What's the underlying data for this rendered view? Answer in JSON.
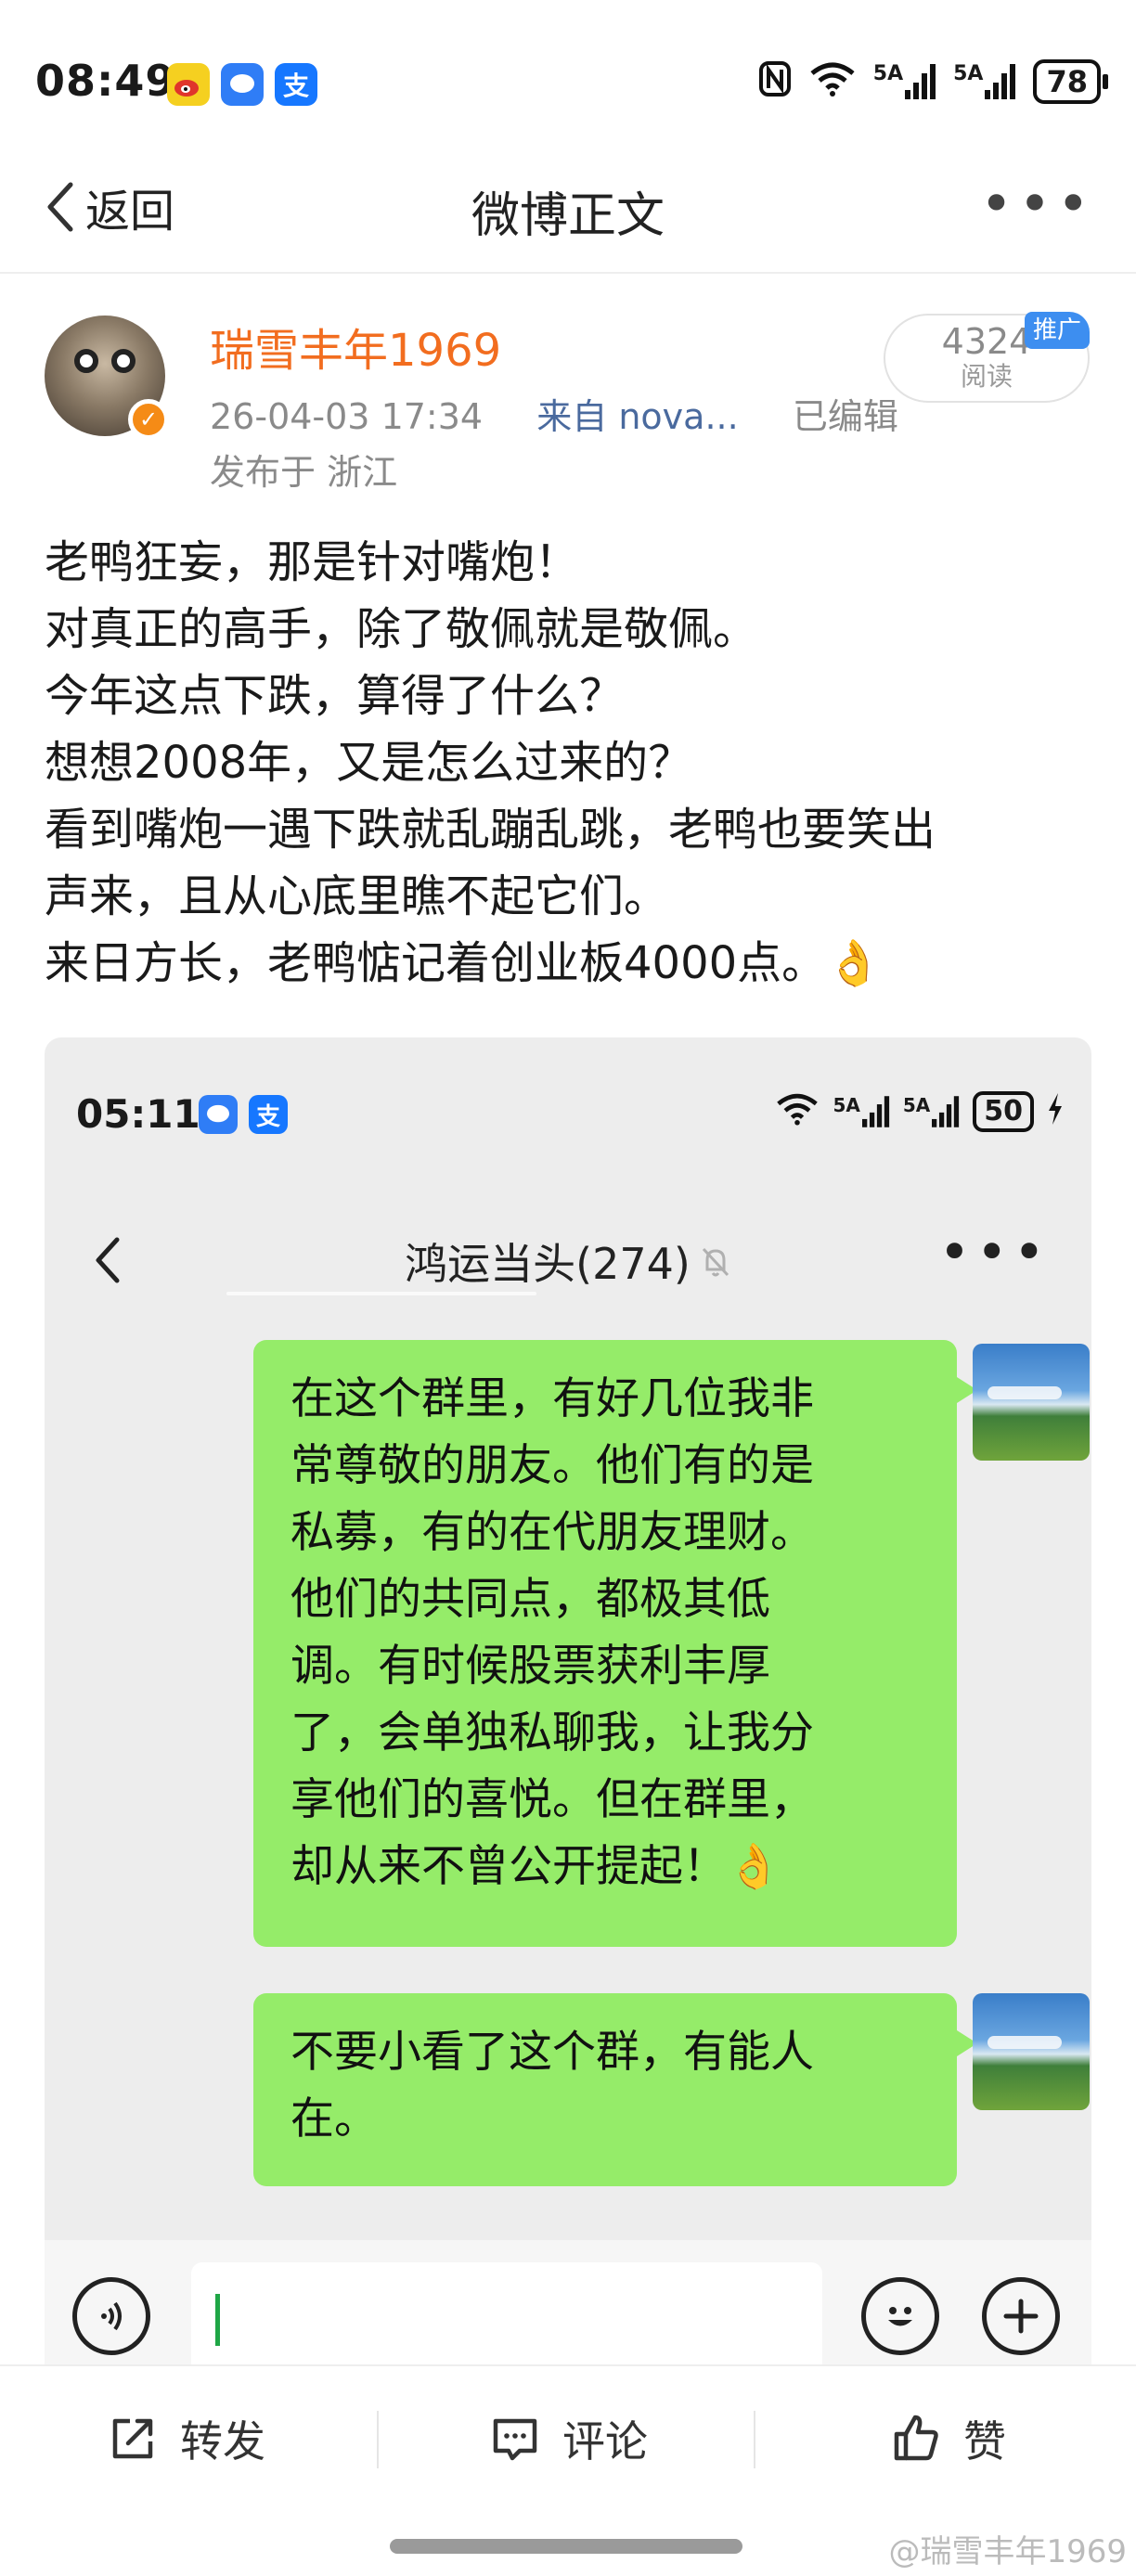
{
  "status_bar": {
    "time": "08:49",
    "network_1": "5A",
    "network_2": "5A",
    "battery": "78",
    "apps": [
      "weibo-icon",
      "message-icon",
      "alipay-icon"
    ]
  },
  "nav": {
    "back_label": "返回",
    "title": "微博正文"
  },
  "post": {
    "author": "瑞雪丰年1969",
    "date": "26-04-03 17:34",
    "source": "来自 nova...",
    "edited": "已编辑",
    "location": "发布于 浙江",
    "reads": "4324",
    "reads_label": "阅读",
    "promo_badge": "推广",
    "lines": [
      "老鸭狂妄，那是针对嘴炮！",
      "对真正的高手，除了敬佩就是敬佩。",
      "今年这点下跌，算得了什么？",
      "想想2008年，又是怎么过来的？",
      "看到嘴炮一遇下跌就乱蹦乱跳，老鸭也要笑出",
      "声来，且从心底里瞧不起它们。",
      "来日方长，老鸭惦记着创业板4000点。👌"
    ]
  },
  "screenshot": {
    "time": "05:11",
    "network_1": "5A",
    "network_2": "5A",
    "battery": "50",
    "chat_title": "鸿运当头(274)",
    "messages": [
      {
        "lines": [
          "在这个群里，有好几位我非",
          "常尊敬的朋友。他们有的是",
          "私募，有的在代朋友理财。",
          "他们的共同点，都极其低",
          "调。有时候股票获利丰厚",
          "了，会单独私聊我，让我分",
          "享他们的喜悦。但在群里，",
          "却从来不曾公开提起！👌"
        ]
      },
      {
        "lines": [
          "不要小看了这个群，有能人",
          "在。"
        ]
      }
    ]
  },
  "actions": {
    "forward": "转发",
    "comment": "评论",
    "like": "赞"
  },
  "watermark": "@瑞雪丰年1969",
  "colors": {
    "author": "#f26d1f",
    "promo": "#3d8ef0",
    "bubble": "#95ec69",
    "caret": "#1fa646"
  }
}
